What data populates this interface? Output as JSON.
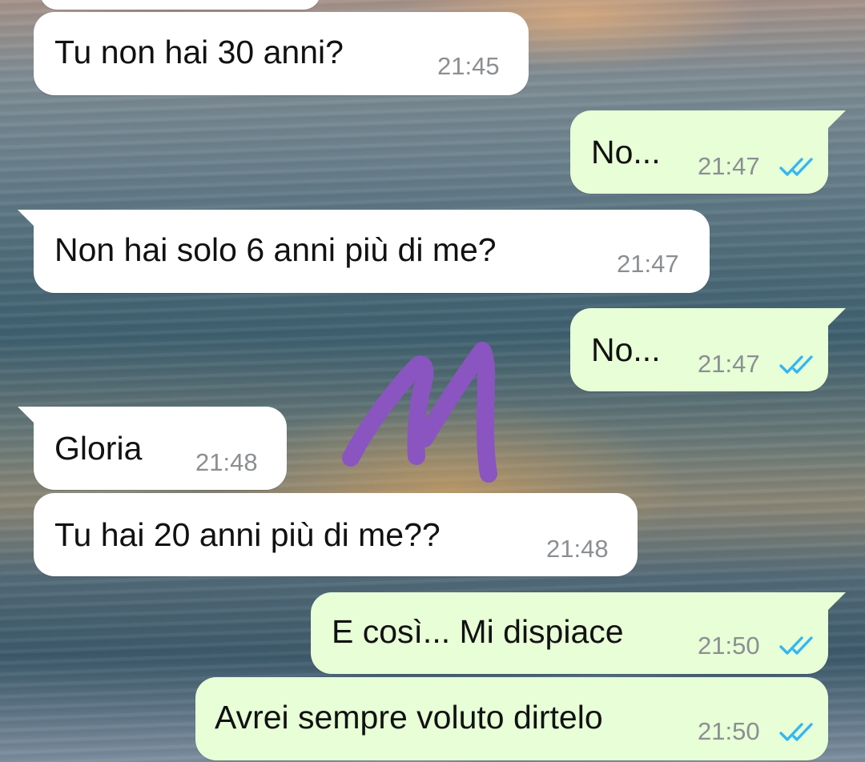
{
  "colors": {
    "incoming_bubble": "#ffffff",
    "outgoing_bubble": "#e7fed7",
    "timestamp": "#8b8f92",
    "read_ticks": "#34b7f1",
    "scribble": "#8a55c0"
  },
  "icons": {
    "read_receipt": "double-check-icon"
  },
  "messages": [
    {
      "direction": "incoming",
      "text": "Tu non hai 30 anni?",
      "time": "21:45"
    },
    {
      "direction": "outgoing",
      "text": "No...",
      "time": "21:47",
      "status": "read"
    },
    {
      "direction": "incoming",
      "text": "Non hai solo 6 anni più di me?",
      "time": "21:47"
    },
    {
      "direction": "outgoing",
      "text": "No...",
      "time": "21:47",
      "status": "read"
    },
    {
      "direction": "incoming",
      "text": "Gloria",
      "time": "21:48"
    },
    {
      "direction": "incoming",
      "text": "Tu hai 20 anni più di me??",
      "time": "21:48"
    },
    {
      "direction": "outgoing",
      "text": "E così... Mi dispiace",
      "time": "21:50",
      "status": "read"
    },
    {
      "direction": "outgoing",
      "text": "Avrei sempre voluto dirtelo",
      "time": "21:50",
      "status": "read"
    }
  ]
}
